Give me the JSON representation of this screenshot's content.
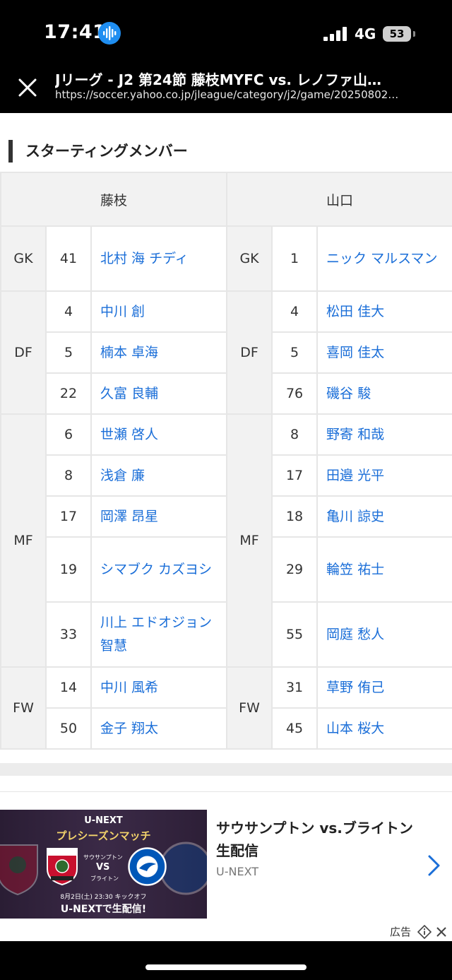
{
  "status": {
    "time": "17:41",
    "network": "4G",
    "battery": "53"
  },
  "header": {
    "title": "Jリーグ - J2 第24節 藤枝MYFC vs. レノファ山…",
    "url": "https://soccer.yahoo.co.jp/jleague/category/j2/game/20250802…"
  },
  "section": {
    "title": "スターティングメンバー"
  },
  "lineup": {
    "home_team": "藤枝",
    "away_team": "山口",
    "rows": [
      {
        "pos": "GK",
        "home_no": "41",
        "home_name": "北村 海 チディ",
        "away_pos": "GK",
        "away_no": "1",
        "away_name": "ニック マルスマン"
      },
      {
        "pos": "DF",
        "home_no": "4",
        "home_name": "中川 創",
        "away_pos": "DF",
        "away_no": "4",
        "away_name": "松田 佳大"
      },
      {
        "home_no": "5",
        "home_name": "楠本 卓海",
        "away_no": "5",
        "away_name": "喜岡 佳太"
      },
      {
        "home_no": "22",
        "home_name": "久富 良輔",
        "away_no": "76",
        "away_name": "磯谷 駿"
      },
      {
        "pos": "MF",
        "home_no": "6",
        "home_name": "世瀬 啓人",
        "away_pos": "MF",
        "away_no": "8",
        "away_name": "野寄 和哉"
      },
      {
        "home_no": "8",
        "home_name": "浅倉 廉",
        "away_no": "17",
        "away_name": "田邉 光平"
      },
      {
        "home_no": "17",
        "home_name": "岡澤 昂星",
        "away_no": "18",
        "away_name": "亀川 諒史"
      },
      {
        "home_no": "19",
        "home_name": "シマブク カズヨシ",
        "away_no": "29",
        "away_name": "輪笠 祐士"
      },
      {
        "home_no": "33",
        "home_name": "川上 エドオジョン 智慧",
        "away_no": "55",
        "away_name": "岡庭 愁人"
      },
      {
        "pos": "FW",
        "home_no": "14",
        "home_name": "中川 風希",
        "away_pos": "FW",
        "away_no": "31",
        "away_name": "草野 侑己"
      },
      {
        "home_no": "50",
        "home_name": "金子 翔太",
        "away_no": "45",
        "away_name": "山本 桜大"
      }
    ]
  },
  "ad": {
    "image": {
      "brand": "U-NEXT",
      "match": "プレシーズンマッチ",
      "team1": "サウサンプトン",
      "vs": "VS",
      "team2": "ブライトン",
      "date": "8月2日(土) 23:30 キックオフ",
      "live": "U-NEXTで生配信!"
    },
    "headline": "サウサンプトン vs.ブライトン 生配信",
    "source": "U-NEXT",
    "label": "広告"
  }
}
